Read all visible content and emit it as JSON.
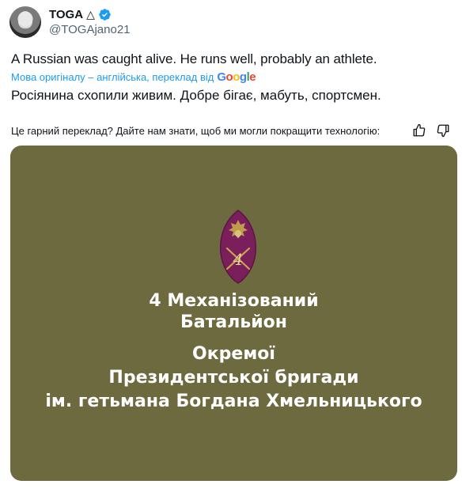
{
  "author": {
    "name": "TOGA",
    "name_suffix": "△",
    "handle": "@TOGAjano21"
  },
  "tweet": {
    "text": "A Russian was caught alive. He runs well, probably an athlete.",
    "translation_label": "Мова оригіналу – англійська, переклад від",
    "translation_provider": "Google",
    "translated_text": "Росіянина схопили живим. Добре бігає, мабуть, спортсмен."
  },
  "feedback": {
    "prompt": "Це гарний переклад? Дайте нам знати, щоб ми могли покращити технологію:",
    "like_icon": "thumbs-up-icon",
    "dislike_icon": "thumbs-down-icon"
  },
  "media": {
    "background_color": "#6e6a3f",
    "emblem_icon": "brigade-shield-emblem",
    "emblem_number": "4",
    "lines": [
      "4 Механізований",
      "Батальйон",
      "Окремої",
      "Президентської бригади",
      "ім. гетьмана Богдана Хмельницького"
    ]
  },
  "colors": {
    "link": "#1d9bf0",
    "verified": "#1d9bf0",
    "emblem": "#7a1f5c",
    "emblem_accent": "#c9a84a"
  }
}
